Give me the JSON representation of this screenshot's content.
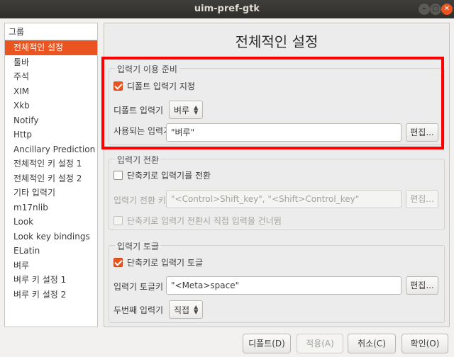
{
  "window": {
    "title": "uim-pref-gtk"
  },
  "sidebar": {
    "header": "그룹",
    "items": [
      "전체적인 설정",
      "툴바",
      "주석",
      "XIM",
      "Xkb",
      "Notify",
      "Http",
      "Ancillary Prediction",
      "전체적인 키 설정 1",
      "전체적인 키 설정 2",
      "기타 입력기",
      "m17nlib",
      "Look",
      "Look key bindings",
      "ELatin",
      "벼루",
      "벼루 키 설정 1",
      "벼루 키 설정 2"
    ],
    "selected_index": 0
  },
  "main": {
    "title": "전체적인 설정",
    "group1": {
      "title": "입력기 이용 준비",
      "default_check_label": "디폴트 입력기 지정",
      "default_check_checked": true,
      "default_im_label": "디폴트 입력기",
      "default_im_value": "벼루",
      "enabled_im_label": "사용되는 입력기",
      "enabled_im_value": "\"벼루\"",
      "edit_label": "편집..."
    },
    "group2": {
      "title": "입력기 전환",
      "switch_check_label": "단축키로 입력기를 전환",
      "switch_check_checked": false,
      "switch_key_label": "입력기 전환 키",
      "switch_key_value": "\"<Control>Shift_key\", \"<Shift>Control_key\"",
      "edit_label": "편집...",
      "skip_check_label": "단축키로 입력기 전환시 직접 입력을 건너뜀"
    },
    "group3": {
      "title": "입력기 토글",
      "toggle_check_label": "단축키로 입력기 토글",
      "toggle_check_checked": true,
      "toggle_key_label": "입력기 토글키",
      "toggle_key_value": "\"<Meta>space\"",
      "edit_label": "편집...",
      "second_im_label": "두번째 입력기",
      "second_im_value": "직접"
    }
  },
  "buttons": {
    "defaults": "디폴트(D)",
    "apply": "적용(A)",
    "cancel": "취소(C)",
    "ok": "확인(O)"
  },
  "colors": {
    "accent": "#e95420",
    "highlight_border": "#ff0000"
  }
}
